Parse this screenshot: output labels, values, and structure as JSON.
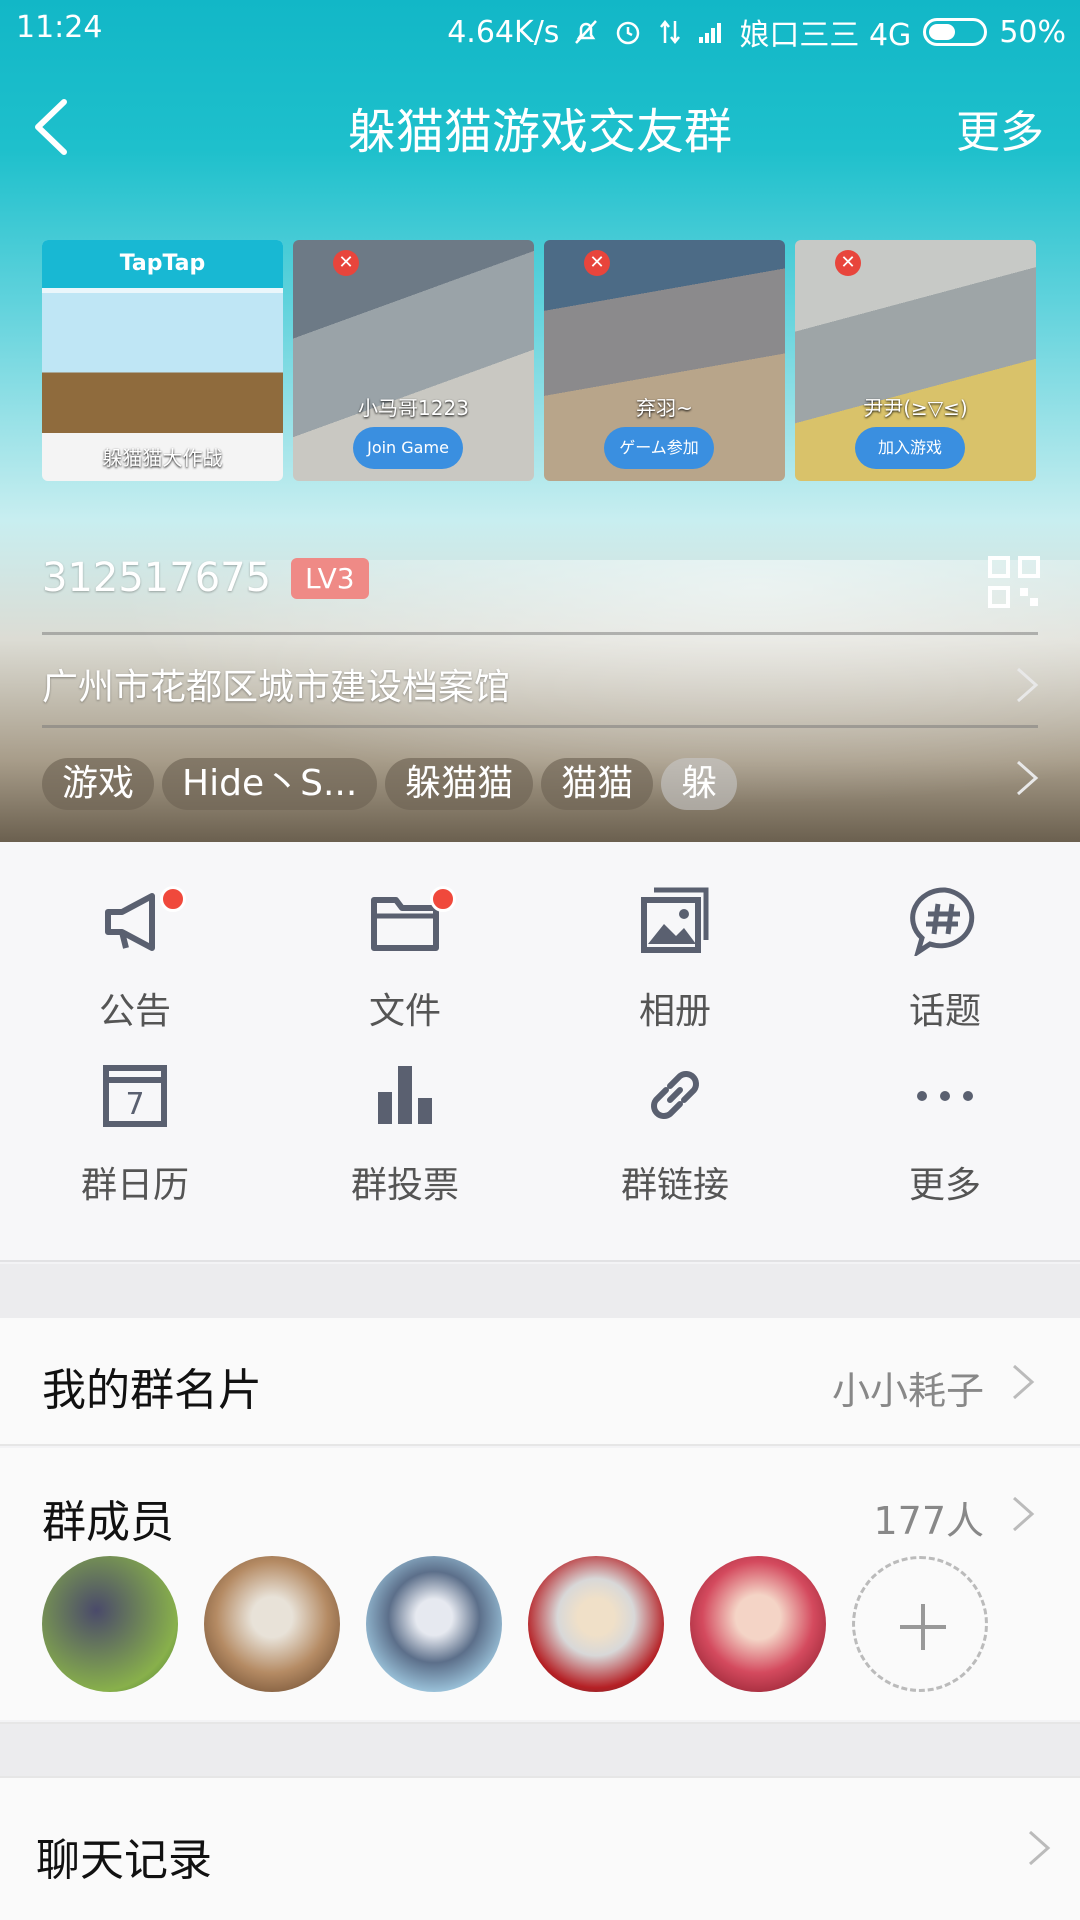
{
  "status_bar": {
    "time": "11:24",
    "network_speed": "4.64K/s",
    "carrier": "娘口三三 4G",
    "battery": "50%",
    "battery_level": 0.5
  },
  "nav": {
    "back_icon": "chevron-left-icon",
    "title": "躲猫猫游戏交友群",
    "more_label": "更多"
  },
  "thumbnails": [
    {
      "header": "TapTap",
      "caption": "躲猫猫大作战"
    },
    {
      "caption": "小马哥1223",
      "button": "Join Game"
    },
    {
      "caption": "弃羽~",
      "button": "ゲーム参加"
    },
    {
      "caption": "尹尹(≥▽≤)",
      "button": "加入游戏"
    }
  ],
  "group": {
    "id": "312517675",
    "level": "LV3",
    "location": "广州市花都区城市建设档案馆",
    "tags": [
      "游戏",
      "Hide丶S...",
      "躲猫猫",
      "猫猫",
      "躲"
    ]
  },
  "grid": [
    {
      "label": "公告",
      "icon": "megaphone-icon",
      "badge": true
    },
    {
      "label": "文件",
      "icon": "folder-icon",
      "badge": true
    },
    {
      "label": "相册",
      "icon": "album-icon",
      "badge": false
    },
    {
      "label": "话题",
      "icon": "hashtag-bubble-icon",
      "badge": false
    },
    {
      "label": "群日历",
      "icon": "calendar-icon",
      "badge": false,
      "day": "7"
    },
    {
      "label": "群投票",
      "icon": "bar-chart-icon",
      "badge": false
    },
    {
      "label": "群链接",
      "icon": "link-icon",
      "badge": false
    },
    {
      "label": "更多",
      "icon": "ellipsis-icon",
      "badge": false
    }
  ],
  "my_card": {
    "label": "我的群名片",
    "value": "小小耗子"
  },
  "members": {
    "label": "群成员",
    "count": "177人"
  },
  "chat_history": {
    "label": "聊天记录"
  },
  "colors": {
    "accent": "#12b7c7",
    "badge_red": "#f0493c",
    "level_badge": "#ef8a86"
  }
}
